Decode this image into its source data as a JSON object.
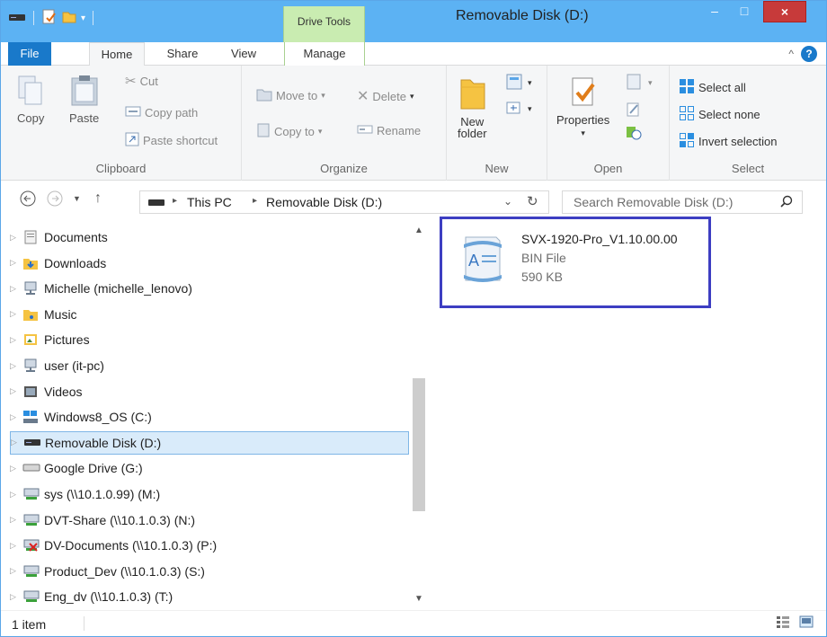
{
  "window": {
    "title": "Removable Disk (D:)",
    "contextual_tab_group": "Drive Tools",
    "controls": {
      "minimize": "–",
      "maximize": "□",
      "close": "×"
    }
  },
  "tabs": [
    {
      "label": "File"
    },
    {
      "label": "Home"
    },
    {
      "label": "Share"
    },
    {
      "label": "View"
    },
    {
      "label": "Manage"
    }
  ],
  "ribbon": {
    "clipboard": {
      "group_label": "Clipboard",
      "copy": "Copy",
      "paste": "Paste",
      "cut": "Cut",
      "copy_path": "Copy path",
      "paste_shortcut": "Paste shortcut"
    },
    "organize": {
      "group_label": "Organize",
      "move_to": "Move to",
      "copy_to": "Copy to",
      "delete": "Delete",
      "rename": "Rename"
    },
    "new": {
      "group_label": "New",
      "new_folder_line1": "New",
      "new_folder_line2": "folder"
    },
    "open": {
      "group_label": "Open",
      "properties": "Properties"
    },
    "select": {
      "group_label": "Select",
      "select_all": "Select all",
      "select_none": "Select none",
      "invert_selection": "Invert selection"
    }
  },
  "address": {
    "breadcrumb": [
      "This PC",
      "Removable Disk (D:)"
    ],
    "search_placeholder": "Search Removable Disk (D:)"
  },
  "nav_tree": [
    {
      "label": "Documents",
      "icon": "documents-folder-icon"
    },
    {
      "label": "Downloads",
      "icon": "downloads-folder-icon"
    },
    {
      "label": "Michelle (michelle_lenovo)",
      "icon": "network-computer-icon"
    },
    {
      "label": "Music",
      "icon": "music-folder-icon"
    },
    {
      "label": "Pictures",
      "icon": "pictures-folder-icon"
    },
    {
      "label": "user (it-pc)",
      "icon": "network-computer-icon"
    },
    {
      "label": "Videos",
      "icon": "videos-folder-icon"
    },
    {
      "label": "Windows8_OS (C:)",
      "icon": "system-drive-icon"
    },
    {
      "label": "Removable Disk (D:)",
      "icon": "removable-drive-icon",
      "selected": true
    },
    {
      "label": "Google Drive (G:)",
      "icon": "drive-icon"
    },
    {
      "label": "sys (\\\\10.1.0.99) (M:)",
      "icon": "network-drive-icon"
    },
    {
      "label": "DVT-Share (\\\\10.1.0.3) (N:)",
      "icon": "network-drive-icon"
    },
    {
      "label": "DV-Documents (\\\\10.1.0.3) (P:)",
      "icon": "disconnected-network-drive-icon"
    },
    {
      "label": "Product_Dev (\\\\10.1.0.3) (S:)",
      "icon": "network-drive-icon"
    },
    {
      "label": "Eng_dv (\\\\10.1.0.3) (T:)",
      "icon": "network-drive-icon"
    }
  ],
  "files": [
    {
      "name": "SVX-1920-Pro_V1.10.00.00",
      "type": "BIN File",
      "size": "590 KB",
      "icon": "bin-file-icon"
    }
  ],
  "status": {
    "item_count": "1 item"
  },
  "colors": {
    "titlebar": "#5cb2f3",
    "file_tab": "#1979ca",
    "drive_tools": "#c9ecb1",
    "selection": "#d9ebfa",
    "highlight_border": "#3d3ec2"
  }
}
